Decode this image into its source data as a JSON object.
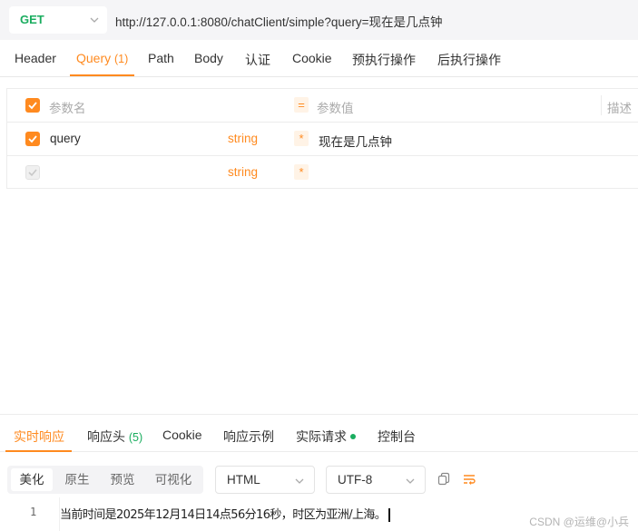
{
  "request": {
    "method": "GET",
    "url": "http://127.0.0.1:8080/chatClient/simple?query=现在是几点钟"
  },
  "tabs": [
    {
      "label": "Header",
      "count": ""
    },
    {
      "label": "Query",
      "count": "(1)"
    },
    {
      "label": "Path",
      "count": ""
    },
    {
      "label": "Body",
      "count": ""
    },
    {
      "label": "认证",
      "count": ""
    },
    {
      "label": "Cookie",
      "count": ""
    },
    {
      "label": "预执行操作",
      "count": ""
    },
    {
      "label": "后执行操作",
      "count": ""
    }
  ],
  "params_table": {
    "header": {
      "name": "参数名",
      "equals": "=",
      "value": "参数值",
      "desc": "描述"
    },
    "rows": [
      {
        "checked": true,
        "name": "query",
        "type": "string",
        "required": "*",
        "value": "现在是几点钟"
      },
      {
        "checked": false,
        "name": "",
        "type": "string",
        "required": "*",
        "value": ""
      }
    ]
  },
  "response_tabs": [
    {
      "label": "实时响应",
      "count": ""
    },
    {
      "label": "响应头",
      "count": "(5)"
    },
    {
      "label": "Cookie",
      "count": ""
    },
    {
      "label": "响应示例",
      "count": ""
    },
    {
      "label": "实际请求",
      "count": ""
    },
    {
      "label": "控制台",
      "count": ""
    }
  ],
  "view_modes": [
    "美化",
    "原生",
    "预览",
    "可视化"
  ],
  "format_select": "HTML",
  "encoding_select": "UTF-8",
  "response_body": {
    "line_number": "1",
    "text": "当前时间是2025年12月14日14点56分16秒，时区为亚洲/上海。"
  },
  "watermark": "CSDN @运维@小兵",
  "colors": {
    "accent": "#ff8a1f",
    "get": "#1aad5f",
    "status_dot": "#1aad5f"
  }
}
